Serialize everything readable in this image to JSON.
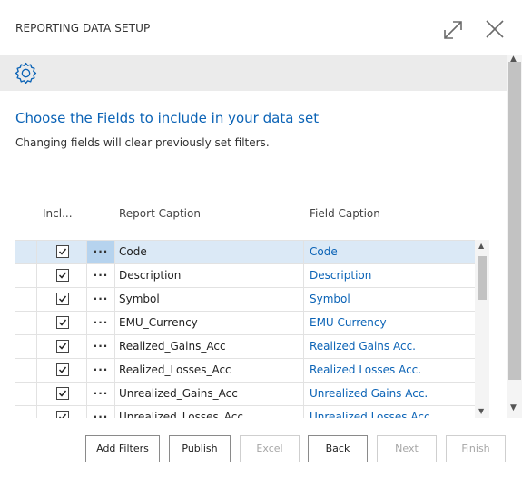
{
  "window": {
    "title": "REPORTING DATA SETUP"
  },
  "intro": {
    "heading": "Choose the Fields to include in your data set",
    "subtext": "Changing fields will clear previously set filters."
  },
  "grid": {
    "headers": {
      "include": "Incl...",
      "report_caption": "Report Caption",
      "field_caption": "Field Caption"
    },
    "rows": [
      {
        "include": true,
        "menu": "···",
        "report_caption": "Code",
        "field_caption": "Code",
        "selected": true
      },
      {
        "include": true,
        "menu": "···",
        "report_caption": "Description",
        "field_caption": "Description",
        "selected": false
      },
      {
        "include": true,
        "menu": "···",
        "report_caption": "Symbol",
        "field_caption": "Symbol",
        "selected": false
      },
      {
        "include": true,
        "menu": "···",
        "report_caption": "EMU_Currency",
        "field_caption": "EMU Currency",
        "selected": false
      },
      {
        "include": true,
        "menu": "···",
        "report_caption": "Realized_Gains_Acc",
        "field_caption": "Realized Gains Acc.",
        "selected": false
      },
      {
        "include": true,
        "menu": "···",
        "report_caption": "Realized_Losses_Acc",
        "field_caption": "Realized Losses Acc.",
        "selected": false
      },
      {
        "include": true,
        "menu": "···",
        "report_caption": "Unrealized_Gains_Acc",
        "field_caption": "Unrealized Gains Acc.",
        "selected": false
      },
      {
        "include": true,
        "menu": "···",
        "report_caption": "Unrealized_Losses_Acc",
        "field_caption": "Unrealized Losses Acc.",
        "selected": false
      }
    ]
  },
  "footer": {
    "add_filters": "Add Filters",
    "publish": "Publish",
    "excel": "Excel",
    "back": "Back",
    "next": "Next",
    "finish": "Finish"
  },
  "icons": {
    "expand": "expand-icon",
    "close": "close-icon",
    "gear": "gear-icon",
    "checkbox": "checkmark-icon"
  },
  "colors": {
    "accent": "#0b63b6",
    "selected_row": "#dbe9f6",
    "action_bar": "#ebebeb"
  }
}
